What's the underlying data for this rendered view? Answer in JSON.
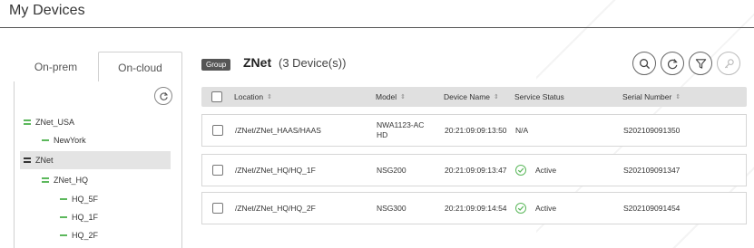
{
  "page": {
    "title": "My Devices"
  },
  "tabs": [
    {
      "label": "On-prem",
      "active": false
    },
    {
      "label": "On-cloud",
      "active": true
    }
  ],
  "tree": {
    "items": [
      {
        "label": "ZNet_USA",
        "level": 0,
        "style": "double"
      },
      {
        "label": "NewYork",
        "level": 1,
        "style": "single"
      },
      {
        "label": "ZNet",
        "level": 0,
        "style": "dark",
        "selected": true
      },
      {
        "label": "ZNet_HQ",
        "level": 1,
        "style": "double"
      },
      {
        "label": "HQ_5F",
        "level": 2,
        "style": "single"
      },
      {
        "label": "HQ_1F",
        "level": 2,
        "style": "single"
      },
      {
        "label": "HQ_2F",
        "level": 2,
        "style": "single"
      }
    ]
  },
  "header": {
    "badge": "Group",
    "group_name": "ZNet",
    "device_count": "(3 Device(s))"
  },
  "table": {
    "columns": [
      "Location",
      "Model",
      "Device Name",
      "Service Status",
      "Serial Number"
    ],
    "sortable": [
      true,
      true,
      true,
      false,
      true
    ],
    "rows": [
      {
        "location": "/ZNet/ZNet_HAAS/HAAS",
        "model": "NWA1123-AC HD",
        "device_name": "20:21:09:09:13:50",
        "status": "N/A",
        "serial": "S202109091350"
      },
      {
        "location": "/ZNet/ZNet_HQ/HQ_1F",
        "model": "NSG200",
        "device_name": "20:21:09:09:13:47",
        "status": "Active",
        "serial": "S202109091347"
      },
      {
        "location": "/ZNet/ZNet_HQ/HQ_2F",
        "model": "NSG300",
        "device_name": "20:21:09:09:14:54",
        "status": "Active",
        "serial": "S202109091454"
      }
    ]
  },
  "colors": {
    "accent_green": "#5cb85c",
    "header_gray": "#e0e0e0",
    "badge_dark": "#555555"
  },
  "icons": {
    "tree_refresh": "refresh-icon",
    "actions": [
      "search-icon",
      "refresh-icon",
      "filter-icon",
      "key-icon"
    ],
    "status_active": "check-circle-icon"
  }
}
